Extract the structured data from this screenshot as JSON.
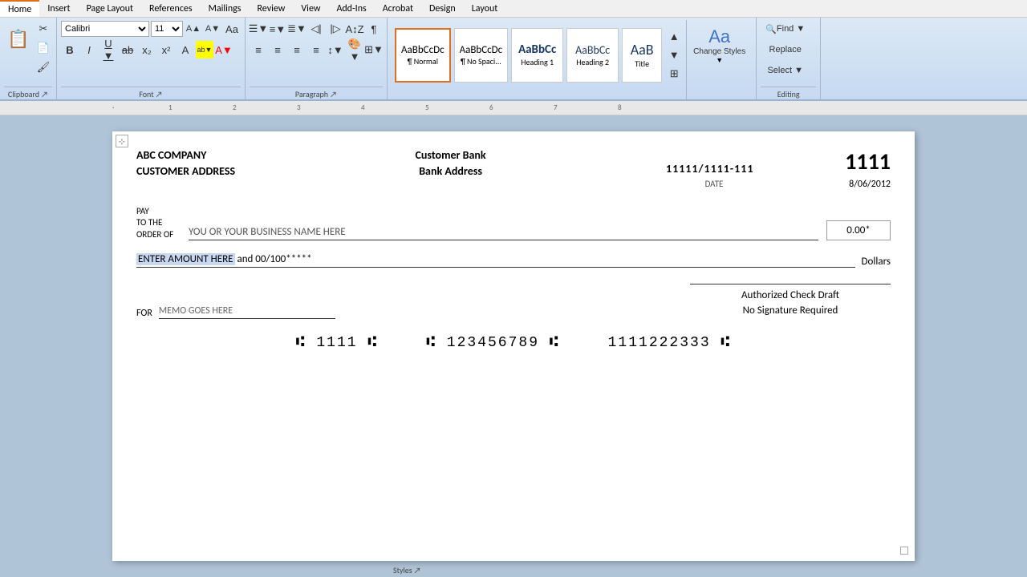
{
  "menu": {
    "items": [
      "Home",
      "Insert",
      "Page Layout",
      "References",
      "Mailings",
      "Review",
      "View",
      "Add-Ins",
      "Acrobat",
      "Design",
      "Layout"
    ],
    "active": "Home"
  },
  "ribbon": {
    "font_family": "Calibri",
    "font_size": "11",
    "styles": [
      {
        "label": "AaBbCcDc",
        "sublabel": "¶ Normal",
        "active": true
      },
      {
        "label": "AaBbCcDc",
        "sublabel": "¶ No Spaci...",
        "active": false
      },
      {
        "label": "AaBbCc",
        "sublabel": "Heading 1",
        "active": false
      },
      {
        "label": "AaBbCc",
        "sublabel": "Heading 2",
        "active": false
      },
      {
        "label": "AaB",
        "sublabel": "Title",
        "active": false
      }
    ],
    "change_styles_label": "Change Styles",
    "find_label": "Find ▼",
    "replace_label": "Replace",
    "select_label": "Select ▼",
    "editing_label": "Editing"
  },
  "check": {
    "company_name": "ABC COMPANY",
    "company_address": "CUSTOMER ADDRESS",
    "bank_name": "Customer Bank",
    "bank_address": "Bank Address",
    "routing_number": "11111/1111-111",
    "date_label": "DATE",
    "date_value": "8/06/2012",
    "check_number": "1111",
    "pay_label_line1": "PAY",
    "pay_label_line2": "TO THE",
    "pay_label_line3": "ORDER OF",
    "payee_placeholder": "YOU OR YOUR BUSINESS NAME HERE",
    "amount_value": "0.00*",
    "amount_text": "ENTER AMOUNT HERE",
    "amount_text2": " and 00/100*****",
    "dollars_label": "Dollars",
    "memo_label": "FOR",
    "memo_value": "MEMO GOES HERE",
    "authorized_line1": "Authorized Check Draft",
    "authorized_line2": "No Signature Required",
    "micr_routing": "⑆ 1111 ⑆",
    "micr_account": "⑆ 123456789 ⑆",
    "micr_check": "1111222333 ⑆"
  }
}
